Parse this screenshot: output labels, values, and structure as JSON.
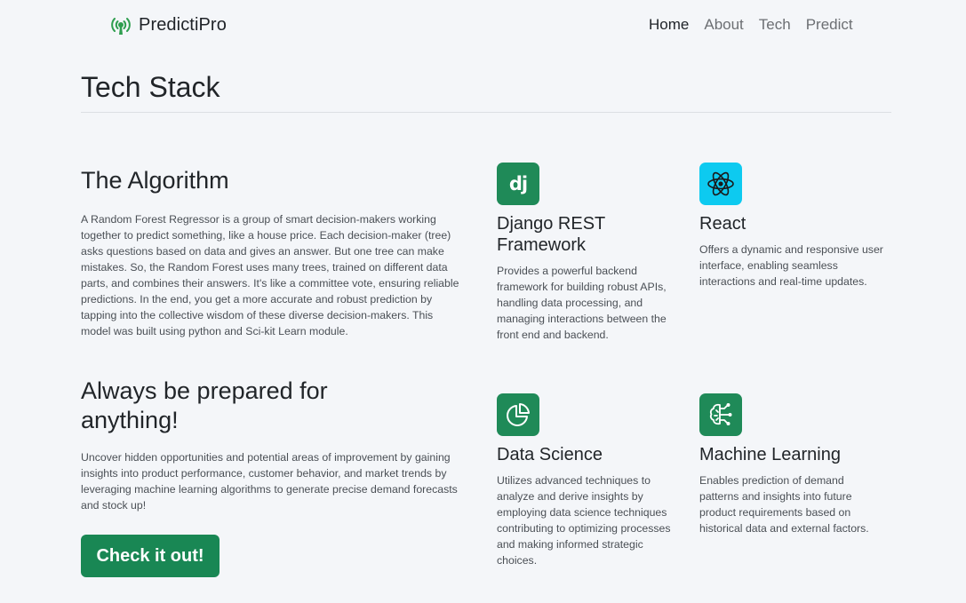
{
  "nav": {
    "brand": "PredictiPro",
    "links": [
      "Home",
      "About",
      "Tech",
      "Predict"
    ],
    "active": "Home"
  },
  "page": {
    "title": "Tech Stack"
  },
  "algorithm": {
    "title": "The Algorithm",
    "text": "A Random Forest Regressor is a group of smart decision-makers working together to predict something, like a house price. Each decision-maker (tree) asks questions based on data and gives an answer. But one tree can make mistakes. So, the Random Forest uses many trees, trained on different data parts, and combines their answers. It's like a committee vote, ensuring reliable predictions. In the end, you get a more accurate and robust prediction by tapping into the collective wisdom of these diverse decision-makers. This model was built using python and Sci-kit Learn module."
  },
  "prepared": {
    "title": "Always be prepared for anything!",
    "text": "Uncover hidden opportunities and potential areas of improvement by gaining insights into product performance, customer behavior, and market trends by leveraging machine learning algorithms to generate precise demand forecasts and stock up!",
    "cta": "Check it out!"
  },
  "features": [
    {
      "title": "Django REST Framework",
      "icon": "django-icon",
      "icon_text": "dj",
      "text": "Provides a powerful backend framework for building robust APIs, handling data processing, and managing interactions between the front end and backend."
    },
    {
      "title": "React",
      "icon": "react-atom-icon",
      "text": "Offers a dynamic and responsive user interface, enabling seamless interactions and real-time updates."
    },
    {
      "title": "Data Science",
      "icon": "pie-chart-icon",
      "text": "Utilizes advanced techniques to analyze and derive insights by employing data science techniques contributing to optimizing processes and making informed strategic choices."
    },
    {
      "title": "Machine Learning",
      "icon": "brain-circuit-icon",
      "text": "Enables prediction of demand patterns and insights into future product requirements based on historical data and external factors."
    }
  ],
  "colors": {
    "accent": "#198754",
    "react_cyan": "#0dcaf0",
    "background": "#f4f6f9"
  }
}
